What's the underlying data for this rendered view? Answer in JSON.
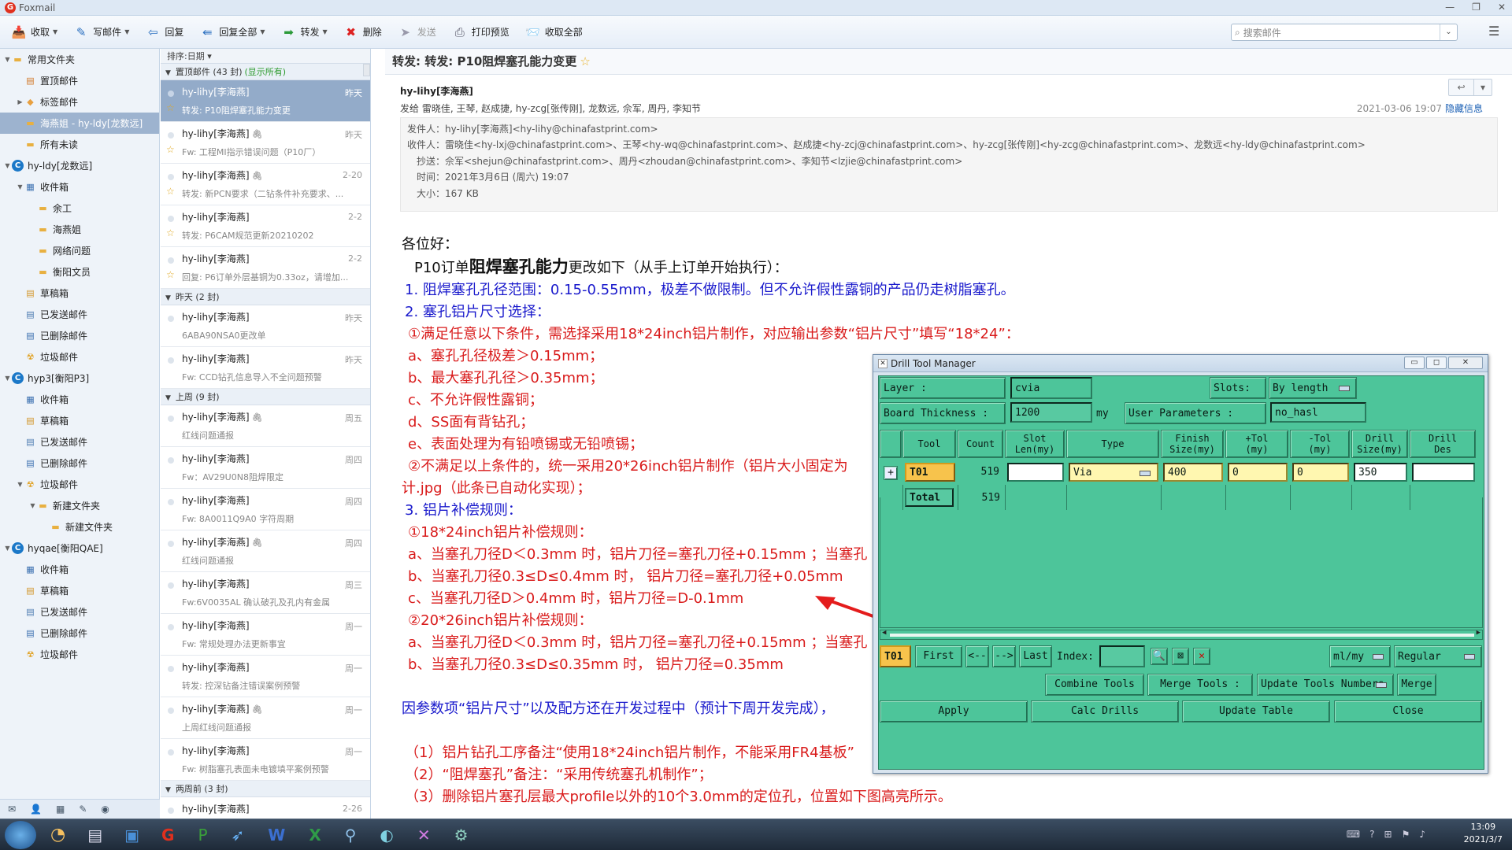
{
  "window": {
    "title": "Foxmail",
    "logo": "G"
  },
  "toolbar": {
    "items": [
      {
        "label": "收取",
        "icon": "inbox-icon",
        "dropdown": true
      },
      {
        "label": "写邮件",
        "icon": "pen-icon",
        "dropdown": true
      },
      {
        "label": "回复",
        "icon": "reply-icon",
        "dropdown": false
      },
      {
        "label": "回复全部",
        "icon": "reply-all-icon",
        "dropdown": true
      },
      {
        "label": "转发",
        "icon": "forward-icon",
        "dropdown": true
      },
      {
        "label": "删除",
        "icon": "delete-icon",
        "dropdown": false
      },
      {
        "label": "发送",
        "icon": "send-icon",
        "dropdown": false,
        "disabled": true
      },
      {
        "label": "打印预览",
        "icon": "print-icon",
        "dropdown": false
      },
      {
        "label": "收取全部",
        "icon": "inbox-all-icon",
        "dropdown": false
      }
    ],
    "search_placeholder": "搜索邮件"
  },
  "folders": [
    {
      "label": "常用文件夹",
      "level": 0,
      "twisty": "▼",
      "icon": "folder"
    },
    {
      "label": "置顶邮件",
      "level": 1,
      "icon": "pin"
    },
    {
      "label": "标签邮件",
      "level": 1,
      "twisty": "▶",
      "icon": "tag"
    },
    {
      "label": "海燕姐 - hy-ldy[龙数远]",
      "level": 1,
      "icon": "folder",
      "selected": true
    },
    {
      "label": "所有未读",
      "level": 1,
      "icon": "folder"
    },
    {
      "label": "hy-ldy[龙数远]",
      "level": 0,
      "twisty": "▼",
      "icon": "account"
    },
    {
      "label": "收件箱",
      "level": 1,
      "twisty": "▼",
      "icon": "inbox"
    },
    {
      "label": "余工",
      "level": 2,
      "icon": "folder"
    },
    {
      "label": "海燕姐",
      "level": 2,
      "icon": "folder"
    },
    {
      "label": "网络问题",
      "level": 2,
      "icon": "folder"
    },
    {
      "label": "衡阳文员",
      "level": 2,
      "icon": "folder"
    },
    {
      "label": "草稿箱",
      "level": 1,
      "icon": "draft"
    },
    {
      "label": "已发送邮件",
      "level": 1,
      "icon": "sent"
    },
    {
      "label": "已删除邮件",
      "level": 1,
      "icon": "deleted"
    },
    {
      "label": "垃圾邮件",
      "level": 1,
      "icon": "junk"
    },
    {
      "label": "hyp3[衡阳P3]",
      "level": 0,
      "twisty": "▼",
      "icon": "account"
    },
    {
      "label": "收件箱",
      "level": 1,
      "icon": "inbox"
    },
    {
      "label": "草稿箱",
      "level": 1,
      "icon": "draft"
    },
    {
      "label": "已发送邮件",
      "level": 1,
      "icon": "sent"
    },
    {
      "label": "已删除邮件",
      "level": 1,
      "icon": "deleted"
    },
    {
      "label": "垃圾邮件",
      "level": 1,
      "twisty": "▼",
      "icon": "junk"
    },
    {
      "label": "新建文件夹",
      "level": 2,
      "twisty": "▼",
      "icon": "folder"
    },
    {
      "label": "新建文件夹",
      "level": 3,
      "icon": "folder"
    },
    {
      "label": "hyqae[衡阳QAE]",
      "level": 0,
      "twisty": "▼",
      "icon": "account"
    },
    {
      "label": "收件箱",
      "level": 1,
      "icon": "inbox"
    },
    {
      "label": "草稿箱",
      "level": 1,
      "icon": "draft"
    },
    {
      "label": "已发送邮件",
      "level": 1,
      "icon": "sent"
    },
    {
      "label": "已删除邮件",
      "level": 1,
      "icon": "deleted"
    },
    {
      "label": "垃圾邮件",
      "level": 1,
      "icon": "junk"
    }
  ],
  "maillist": {
    "sort_label": "排序:日期",
    "groups": [
      {
        "title": "置顶邮件 (43 封)",
        "extra": "(显示所有)",
        "items": [
          {
            "sender": "hy-lihy[李海燕]",
            "date": "昨天",
            "subject": "转发: P10阻焊塞孔能力变更",
            "selected": true,
            "star": true
          },
          {
            "sender": "hy-lihy[李海燕]",
            "date": "昨天",
            "subject": "Fw: 工程MI指示错误问题（P10厂）",
            "attach": true,
            "star": true
          },
          {
            "sender": "hy-lihy[李海燕]",
            "date": "2-20",
            "subject": "转发: 新PCN要求（二钻条件补充要求、...",
            "attach": true,
            "star": true
          },
          {
            "sender": "hy-lihy[李海燕]",
            "date": "2-2",
            "subject": "转发: P6CAM规范更新20210202",
            "star": true
          },
          {
            "sender": "hy-lihy[李海燕]",
            "date": "2-2",
            "subject": "回复: P6订单外层基铜为0.33oz，请增加...",
            "star": true
          }
        ]
      },
      {
        "title": "昨天 (2 封)",
        "items": [
          {
            "sender": "hy-lihy[李海燕]",
            "date": "昨天",
            "subject": "6ABA90NSA0更改单"
          },
          {
            "sender": "hy-lihy[李海燕]",
            "date": "昨天",
            "subject": "Fw: CCD钻孔信息导入不全问题预警"
          }
        ]
      },
      {
        "title": "上周 (9 封)",
        "items": [
          {
            "sender": "hy-lihy[李海燕]",
            "date": "周五",
            "subject": "红线问题通报",
            "attach": true
          },
          {
            "sender": "hy-lihy[李海燕]",
            "date": "周四",
            "subject": "Fw：AV29U0N8阻焊限定"
          },
          {
            "sender": "hy-lihy[李海燕]",
            "date": "周四",
            "subject": "Fw: 8A0011Q9A0  字符周期"
          },
          {
            "sender": "hy-lihy[李海燕]",
            "date": "周四",
            "subject": "红线问题通报",
            "attach": true
          },
          {
            "sender": "hy-lihy[李海燕]",
            "date": "周三",
            "subject": "Fw:6V0035AL 确认破孔及孔内有金属"
          },
          {
            "sender": "hy-lihy[李海燕]",
            "date": "周一",
            "subject": "Fw: 常规处理办法更新事宜"
          },
          {
            "sender": "hy-lihy[李海燕]",
            "date": "周一",
            "subject": "转发: 控深钻备注错误案例预警"
          },
          {
            "sender": "hy-lihy[李海燕]",
            "date": "周一",
            "subject": "上周红线问题通报",
            "attach": true
          },
          {
            "sender": "hy-lihy[李海燕]",
            "date": "周一",
            "subject": "Fw: 树脂塞孔表面未电镀填平案例预警"
          }
        ]
      },
      {
        "title": "两周前 (3 封)",
        "items": [
          {
            "sender": "hy-lihy[李海燕]",
            "date": "2-26",
            "subject": ""
          }
        ]
      }
    ]
  },
  "reader": {
    "title": "转发: 转发: P10阻焊塞孔能力变更",
    "sender": "hy-lihy[李海燕]",
    "sendto_label": "发给",
    "sendto": "雷晓佳, 王琴, 赵成捷, hy-zcg[张传刚], 龙数远, 佘军, 周丹, 李知节",
    "date": "2021-03-06 19:07",
    "hide_info": "隐藏信息",
    "from_k": "发件人：",
    "from_v": "hy-lihy[李海燕]<hy-lihy@chinafastprint.com>",
    "to_k": "收件人：",
    "to_v": "雷晓佳<hy-lxj@chinafastprint.com>、王琴<hy-wq@chinafastprint.com>、赵成捷<hy-zcj@chinafastprint.com>、hy-zcg[张传刚]<hy-zcg@chinafastprint.com>、龙数远<hy-ldy@chinafastprint.com>",
    "cc_k": "抄送：",
    "cc_v": "佘军<shejun@chinafastprint.com>、周丹<zhoudan@chinafastprint.com>、李知节<lzjie@chinafastprint.com>",
    "time_k": "时间：",
    "time_v": "2021年3月6日 (周六) 19:07",
    "size_k": "大小：",
    "size_v": "167 KB",
    "lines": [
      {
        "t": "各位好：",
        "c": "blk"
      },
      {
        "t": "",
        "c": "blk"
      },
      {
        "t": "1. 阻焊塞孔孔径范围：0.15-0.55mm，极差不做限制。但不允许假性露铜的产品仍走树脂塞孔。",
        "c": "blue"
      },
      {
        "t": "2. 塞孔铝片尺寸选择：",
        "c": "blue"
      },
      {
        "t": "①满足任意以下条件，需选择采用18*24inch铝片制作，对应输出参数“铝片尺寸”填写“18*24”：",
        "c": "red"
      },
      {
        "t": "a、塞孔孔径极差＞0.15mm；",
        "c": "red"
      },
      {
        "t": "b、最大塞孔孔径＞0.35mm；",
        "c": "red"
      },
      {
        "t": "c、不允许假性露铜；",
        "c": "red"
      },
      {
        "t": "d、SS面有背钻孔；",
        "c": "red"
      },
      {
        "t": "e、表面处理为有铅喷锡或无铅喷锡；",
        "c": "red"
      },
      {
        "t": "②不满足以上条件的，统一采用20*26inch铝片制作（铝片大小固定为",
        "c": "red"
      },
      {
        "t": "计.jpg（此条已自动化实现）；",
        "c": "red"
      },
      {
        "t": "3. 铝片补偿规则：",
        "c": "blue"
      },
      {
        "t": "①18*24inch铝片补偿规则：",
        "c": "red"
      },
      {
        "t": "a、当塞孔刀径D＜0.3mm 时，铝片刀径=塞孔刀径+0.15mm ；当塞孔",
        "c": "red"
      },
      {
        "t": "b、当塞孔刀径0.3≤D≤0.4mm 时， 铝片刀径=塞孔刀径+0.05mm",
        "c": "red"
      },
      {
        "t": "c、当塞孔刀径D＞0.4mm 时，铝片刀径=D-0.1mm",
        "c": "red"
      },
      {
        "t": "②20*26inch铝片补偿规则：",
        "c": "red"
      },
      {
        "t": "a、当塞孔刀径D＜0.3mm 时，铝片刀径=塞孔刀径+0.15mm ；当塞孔",
        "c": "red"
      },
      {
        "t": "b、当塞孔刀径0.3≤D≤0.35mm 时， 铝片刀径=0.35mm",
        "c": "red"
      },
      {
        "t": "",
        "c": "blk"
      },
      {
        "t": "因参数项“铝片尺寸”以及配方还在开发过程中（预计下周开发完成），",
        "c": "blue"
      },
      {
        "t": "",
        "c": "blk"
      },
      {
        "t": "（1）铝片钻孔工序备注“使用18*24inch铝片制作，不能采用FR4基板”",
        "c": "red"
      },
      {
        "t": "（2）“阻焊塞孔”备注：“采用传统塞孔机制作”；",
        "c": "red"
      },
      {
        "t": "（3）删除铝片塞孔层最大profile以外的10个3.0mm的定位孔，位置如下图高亮所示。",
        "c": "red"
      }
    ],
    "line2_pre": "P10订单",
    "line2_big": "阻焊塞孔能力",
    "line2_post": "更改如下（从手上订单开始执行）："
  },
  "drill": {
    "title": "Drill Tool Manager",
    "layer_label": "Layer          :",
    "layer_value": "cvia",
    "slots_label": "Slots:",
    "slots_value": "By length",
    "thick_label": "Board Thickness  :",
    "thick_value": "1200",
    "thick_unit": "my",
    "userp_label": "User Parameters  :",
    "userp_value": "no_hasl",
    "headers": [
      "Tool",
      "Count",
      "Slot\nLen(my)",
      "Type",
      "Finish\nSize(my)",
      "+Tol\n(my)",
      "-Tol\n(my)",
      "Drill\nSize(my)",
      "Drill\nDes"
    ],
    "row": {
      "plus": "+",
      "tool": "T01",
      "count": "519",
      "slot": "",
      "type": "Via",
      "finish": "400",
      "ptol": "0",
      "mtol": "0",
      "drill": "350",
      "des": ""
    },
    "total_label": "Total",
    "total_count": "519",
    "nav": {
      "current": "T01",
      "first": "First",
      "prev": "<--",
      "next": "-->",
      "last": "Last",
      "index": "Index:",
      "units": "ml/my",
      "mode": "Regular"
    },
    "actions1": [
      "Combine Tools",
      "Merge Tools :",
      "Update Tools Numbers",
      "Merge"
    ],
    "actions2": [
      "Apply",
      "Calc Drills",
      "Update Table",
      "Close"
    ]
  },
  "taskbar": {
    "time": "13:09",
    "date": "2021/3/7"
  },
  "colors": {
    "accent": "#1b78c8",
    "selected_row": "#93abc9",
    "drill_panel": "#4dc59a",
    "highlight_red": "#d91b1b",
    "highlight_blue": "#1a1acc"
  }
}
